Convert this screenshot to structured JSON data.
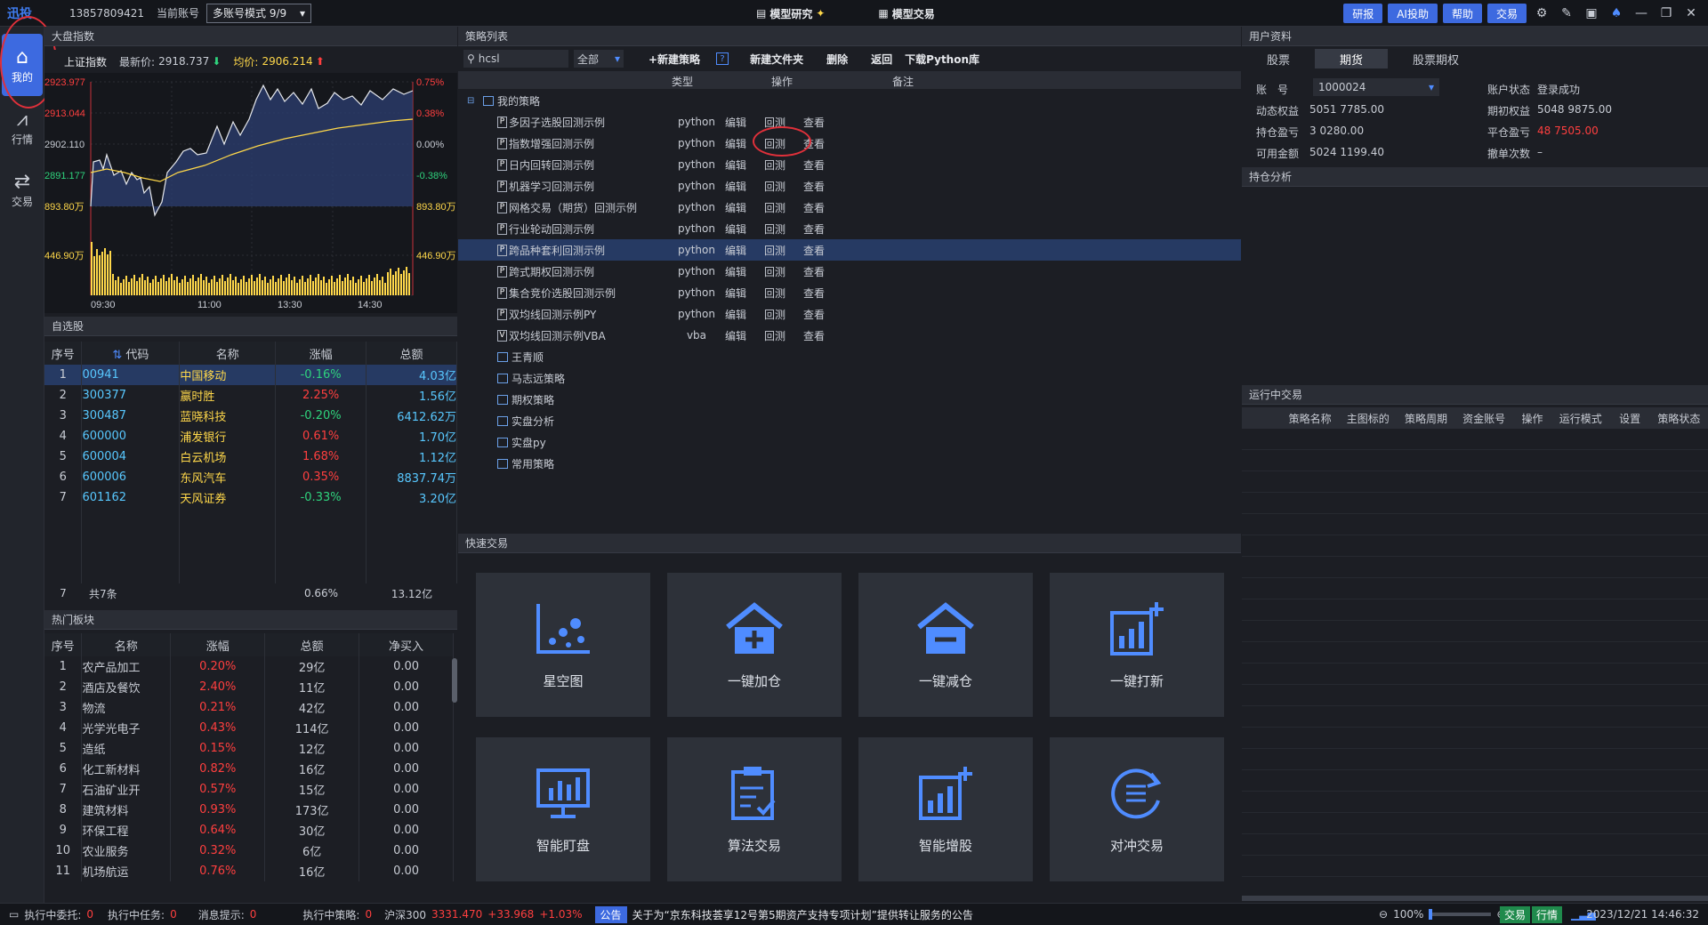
{
  "top": {
    "logo": "迅投",
    "phone": "13857809421",
    "account_label": "当前账号",
    "account_mode": "多账号模式 9/9",
    "tab_research": "模型研究",
    "tab_trade": "模型交易",
    "btn_yanbao": "研报",
    "btn_ai": "AI投助",
    "btn_help": "帮助",
    "btn_trade": "交易"
  },
  "sidebar": {
    "home": "我的",
    "market": "行情",
    "trade": "交易"
  },
  "index_panel": {
    "title": "大盘指数",
    "name": "上证指数",
    "last_label": "最新价:",
    "last_value": "2918.737",
    "avg_label": "均价:",
    "avg_value": "2906.214",
    "y_left": [
      "2923.977",
      "2913.044",
      "2902.110",
      "2891.177",
      "893.80万",
      "446.90万"
    ],
    "y_right": [
      "0.75%",
      "0.38%",
      "0.00%",
      "-0.38%",
      "893.80万",
      "446.90万"
    ],
    "x_ticks": [
      "09:30",
      "11:00",
      "13:30",
      "14:30"
    ]
  },
  "watchlist": {
    "title": "自选股",
    "headers": [
      "序号",
      "代码",
      "名称",
      "涨幅",
      "总额"
    ],
    "rows": [
      [
        "1",
        "00941",
        "中国移动",
        "-0.16%",
        "4.03亿"
      ],
      [
        "2",
        "300377",
        "赢时胜",
        "2.25%",
        "1.56亿"
      ],
      [
        "3",
        "300487",
        "蓝晓科技",
        "-0.20%",
        "6412.62万"
      ],
      [
        "4",
        "600000",
        "浦发银行",
        "0.61%",
        "1.70亿"
      ],
      [
        "5",
        "600004",
        "白云机场",
        "1.68%",
        "1.12亿"
      ],
      [
        "6",
        "600006",
        "东风汽车",
        "0.35%",
        "8837.74万"
      ],
      [
        "7",
        "601162",
        "天风证券",
        "-0.33%",
        "3.20亿"
      ]
    ],
    "footer": [
      "7",
      "共7条",
      "0.66%",
      "13.12亿"
    ]
  },
  "hot_sectors": {
    "title": "热门板块",
    "headers": [
      "序号",
      "名称",
      "涨幅",
      "总额",
      "净买入"
    ],
    "rows": [
      [
        "1",
        "农产品加工",
        "0.20%",
        "29亿",
        "0.00"
      ],
      [
        "2",
        "酒店及餐饮",
        "2.40%",
        "11亿",
        "0.00"
      ],
      [
        "3",
        "物流",
        "0.21%",
        "42亿",
        "0.00"
      ],
      [
        "4",
        "光学光电子",
        "0.43%",
        "114亿",
        "0.00"
      ],
      [
        "5",
        "造纸",
        "0.15%",
        "12亿",
        "0.00"
      ],
      [
        "6",
        "化工新材料",
        "0.82%",
        "16亿",
        "0.00"
      ],
      [
        "7",
        "石油矿业开",
        "0.57%",
        "15亿",
        "0.00"
      ],
      [
        "8",
        "建筑材料",
        "0.93%",
        "173亿",
        "0.00"
      ],
      [
        "9",
        "环保工程",
        "0.64%",
        "30亿",
        "0.00"
      ],
      [
        "10",
        "农业服务",
        "0.32%",
        "6亿",
        "0.00"
      ],
      [
        "11",
        "机场航运",
        "0.76%",
        "16亿",
        "0.00"
      ]
    ]
  },
  "strategy": {
    "title": "策略列表",
    "search_value": "hcsl",
    "filter": "全部",
    "tb_new": "+新建策略",
    "tb_help": "?",
    "tb_folder": "新建文件夹",
    "tb_delete": "删除",
    "tb_back": "返回",
    "tb_download": "下载Python库",
    "col_type": "类型",
    "col_ops": "操作",
    "col_note": "备注",
    "root": "我的策略",
    "items": [
      {
        "name": "多因子选股回测示例",
        "type": "python",
        "icon": "P"
      },
      {
        "name": "指数增强回测示例",
        "type": "python",
        "icon": "P"
      },
      {
        "name": "日内回转回测示例",
        "type": "python",
        "icon": "P"
      },
      {
        "name": "机器学习回测示例",
        "type": "python",
        "icon": "P"
      },
      {
        "name": "网格交易（期货）回测示例",
        "type": "python",
        "icon": "P"
      },
      {
        "name": "行业轮动回测示例",
        "type": "python",
        "icon": "P"
      },
      {
        "name": "跨品种套利回测示例",
        "type": "python",
        "icon": "P"
      },
      {
        "name": "跨式期权回测示例",
        "type": "python",
        "icon": "P"
      },
      {
        "name": "集合竞价选股回测示例",
        "type": "python",
        "icon": "P"
      },
      {
        "name": "双均线回测示例PY",
        "type": "python",
        "icon": "P"
      },
      {
        "name": "双均线回测示例VBA",
        "type": "vba",
        "icon": "V"
      }
    ],
    "op_edit": "编辑",
    "op_backtest": "回测",
    "op_view": "查看",
    "folders": [
      "王青顺",
      "马志远策略",
      "期权策略",
      "实盘分析",
      "实盘py",
      "常用策略"
    ]
  },
  "quick": {
    "title": "快速交易",
    "tiles": [
      "星空图",
      "一键加仓",
      "一键减仓",
      "一键打新",
      "智能盯盘",
      "算法交易",
      "智能增股",
      "对冲交易"
    ]
  },
  "user": {
    "title": "用户资料",
    "tabs": [
      "股票",
      "期货",
      "股票期权"
    ],
    "acct_label": "账　号",
    "acct_value": "1000024",
    "status_label": "账户状态",
    "status_value": "登录成功",
    "dyn_label": "动态权益",
    "dyn_value": "5051 7785.00",
    "init_label": "期初权益",
    "init_value": "5048 9875.00",
    "hold_label": "持仓盈亏",
    "hold_value": "3 0280.00",
    "close_label": "平仓盈亏",
    "close_value": "48 7505.00",
    "avail_label": "可用金额",
    "avail_value": "5024 1199.40",
    "cancel_label": "撤单次数",
    "cancel_value": "–",
    "pos_title": "持仓分析",
    "running_title": "运行中交易",
    "running_headers": [
      "策略名称",
      "主图标的",
      "策略周期",
      "资金账号",
      "操作",
      "运行模式",
      "设置",
      "策略状态"
    ]
  },
  "status": {
    "entrust_label": "执行中委托:",
    "entrust_value": "0",
    "task_label": "执行中任务:",
    "task_value": "0",
    "msg_label": "消息提示:",
    "msg_value": "0",
    "strat_label": "执行中策略:",
    "strat_value": "0",
    "hs300_label": "沪深300",
    "hs300_price": "3331.470",
    "hs300_chg": "+33.968",
    "hs300_pct": "+1.03%",
    "notice_tag": "公告",
    "notice_text": "关于为“京东科技荟享12号第5期资产支持专项计划”提供转让服务的公告",
    "zoom": "100%",
    "btn_trade": "交易",
    "btn_market": "行情",
    "datetime": "2023/12/21 14:46:32"
  },
  "colors": {
    "accent": "#3d6ae0",
    "up": "#ff3f3f",
    "down": "#2fd37d",
    "highlight": "#e0303a"
  }
}
